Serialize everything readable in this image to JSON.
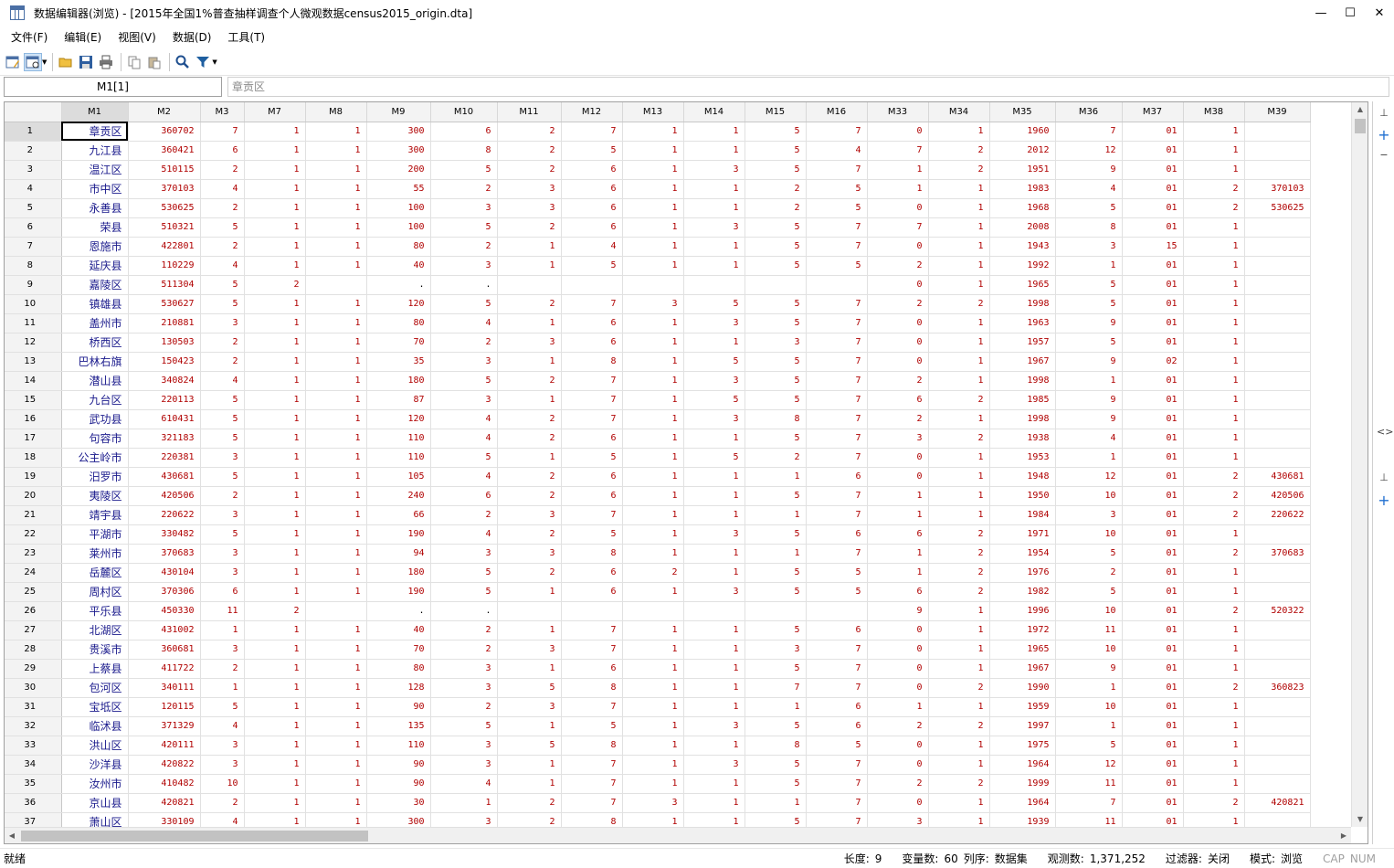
{
  "window": {
    "title": "数据编辑器(浏览) - [2015年全国1%普查抽样调查个人微观数据census2015_origin.dta]",
    "minimize": "—",
    "maximize": "☐",
    "close": "✕"
  },
  "menu": [
    "文件(F)",
    "编辑(E)",
    "视图(V)",
    "数据(D)",
    "工具(T)"
  ],
  "toolbar": {
    "icons": [
      "edit-mode-icon",
      "browse-mode-icon",
      "open-folder-icon",
      "save-icon",
      "print-icon",
      "copy-icon",
      "paste-icon",
      "search-icon",
      "filter-icon"
    ]
  },
  "cell_ref": "M1[1]",
  "cell_value": "章贡区",
  "columns": [
    "M1",
    "M2",
    "M3",
    "M7",
    "M8",
    "M9",
    "M10",
    "M11",
    "M12",
    "M13",
    "M14",
    "M15",
    "M16",
    "M33",
    "M34",
    "M35",
    "M36",
    "M37",
    "M38",
    "M39"
  ],
  "rows": [
    [
      "章贡区",
      "360702",
      "7",
      "1",
      "1",
      "300",
      "6",
      "2",
      "7",
      "1",
      "1",
      "5",
      "7",
      "0",
      "1",
      "1960",
      "7",
      "01",
      "1",
      ""
    ],
    [
      "九江县",
      "360421",
      "6",
      "1",
      "1",
      "300",
      "8",
      "2",
      "5",
      "1",
      "1",
      "5",
      "4",
      "7",
      "2",
      "2012",
      "12",
      "01",
      "1",
      ""
    ],
    [
      "温江区",
      "510115",
      "2",
      "1",
      "1",
      "200",
      "5",
      "2",
      "6",
      "1",
      "3",
      "5",
      "7",
      "1",
      "2",
      "1951",
      "9",
      "01",
      "1",
      ""
    ],
    [
      "市中区",
      "370103",
      "4",
      "1",
      "1",
      "55",
      "2",
      "3",
      "6",
      "1",
      "1",
      "2",
      "5",
      "1",
      "1",
      "1983",
      "4",
      "01",
      "2",
      "370103"
    ],
    [
      "永善县",
      "530625",
      "2",
      "1",
      "1",
      "100",
      "3",
      "3",
      "6",
      "1",
      "1",
      "2",
      "5",
      "0",
      "1",
      "1968",
      "5",
      "01",
      "2",
      "530625"
    ],
    [
      "荣县",
      "510321",
      "5",
      "1",
      "1",
      "100",
      "5",
      "2",
      "6",
      "1",
      "3",
      "5",
      "7",
      "7",
      "1",
      "2008",
      "8",
      "01",
      "1",
      ""
    ],
    [
      "恩施市",
      "422801",
      "2",
      "1",
      "1",
      "80",
      "2",
      "1",
      "4",
      "1",
      "1",
      "5",
      "7",
      "0",
      "1",
      "1943",
      "3",
      "15",
      "1",
      ""
    ],
    [
      "延庆县",
      "110229",
      "4",
      "1",
      "1",
      "40",
      "3",
      "1",
      "5",
      "1",
      "1",
      "5",
      "5",
      "2",
      "1",
      "1992",
      "1",
      "01",
      "1",
      ""
    ],
    [
      "嘉陵区",
      "511304",
      "5",
      "2",
      "",
      ".",
      ".",
      "",
      "",
      "",
      "",
      "",
      "",
      "0",
      "1",
      "1965",
      "5",
      "01",
      "1",
      ""
    ],
    [
      "镇雄县",
      "530627",
      "5",
      "1",
      "1",
      "120",
      "5",
      "2",
      "7",
      "3",
      "5",
      "5",
      "7",
      "2",
      "2",
      "1998",
      "5",
      "01",
      "1",
      ""
    ],
    [
      "盖州市",
      "210881",
      "3",
      "1",
      "1",
      "80",
      "4",
      "1",
      "6",
      "1",
      "3",
      "5",
      "7",
      "0",
      "1",
      "1963",
      "9",
      "01",
      "1",
      ""
    ],
    [
      "桥西区",
      "130503",
      "2",
      "1",
      "1",
      "70",
      "2",
      "3",
      "6",
      "1",
      "1",
      "3",
      "7",
      "0",
      "1",
      "1957",
      "5",
      "01",
      "1",
      ""
    ],
    [
      "巴林右旗",
      "150423",
      "2",
      "1",
      "1",
      "35",
      "3",
      "1",
      "8",
      "1",
      "5",
      "5",
      "7",
      "0",
      "1",
      "1967",
      "9",
      "02",
      "1",
      ""
    ],
    [
      "潜山县",
      "340824",
      "4",
      "1",
      "1",
      "180",
      "5",
      "2",
      "7",
      "1",
      "3",
      "5",
      "7",
      "2",
      "1",
      "1998",
      "1",
      "01",
      "1",
      ""
    ],
    [
      "九台区",
      "220113",
      "5",
      "1",
      "1",
      "87",
      "3",
      "1",
      "7",
      "1",
      "5",
      "5",
      "7",
      "6",
      "2",
      "1985",
      "9",
      "01",
      "1",
      ""
    ],
    [
      "武功县",
      "610431",
      "5",
      "1",
      "1",
      "120",
      "4",
      "2",
      "7",
      "1",
      "3",
      "8",
      "7",
      "2",
      "1",
      "1998",
      "9",
      "01",
      "1",
      ""
    ],
    [
      "句容市",
      "321183",
      "5",
      "1",
      "1",
      "110",
      "4",
      "2",
      "6",
      "1",
      "1",
      "5",
      "7",
      "3",
      "2",
      "1938",
      "4",
      "01",
      "1",
      ""
    ],
    [
      "公主岭市",
      "220381",
      "3",
      "1",
      "1",
      "110",
      "5",
      "1",
      "5",
      "1",
      "5",
      "2",
      "7",
      "0",
      "1",
      "1953",
      "1",
      "01",
      "1",
      ""
    ],
    [
      "汨罗市",
      "430681",
      "5",
      "1",
      "1",
      "105",
      "4",
      "2",
      "6",
      "1",
      "1",
      "1",
      "6",
      "0",
      "1",
      "1948",
      "12",
      "01",
      "2",
      "430681"
    ],
    [
      "夷陵区",
      "420506",
      "2",
      "1",
      "1",
      "240",
      "6",
      "2",
      "6",
      "1",
      "1",
      "5",
      "7",
      "1",
      "1",
      "1950",
      "10",
      "01",
      "2",
      "420506"
    ],
    [
      "靖宇县",
      "220622",
      "3",
      "1",
      "1",
      "66",
      "2",
      "3",
      "7",
      "1",
      "1",
      "1",
      "7",
      "1",
      "1",
      "1984",
      "3",
      "01",
      "2",
      "220622"
    ],
    [
      "平湖市",
      "330482",
      "5",
      "1",
      "1",
      "190",
      "4",
      "2",
      "5",
      "1",
      "3",
      "5",
      "6",
      "6",
      "2",
      "1971",
      "10",
      "01",
      "1",
      ""
    ],
    [
      "莱州市",
      "370683",
      "3",
      "1",
      "1",
      "94",
      "3",
      "3",
      "8",
      "1",
      "1",
      "1",
      "7",
      "1",
      "2",
      "1954",
      "5",
      "01",
      "2",
      "370683"
    ],
    [
      "岳麓区",
      "430104",
      "3",
      "1",
      "1",
      "180",
      "5",
      "2",
      "6",
      "2",
      "1",
      "5",
      "5",
      "1",
      "2",
      "1976",
      "2",
      "01",
      "1",
      ""
    ],
    [
      "周村区",
      "370306",
      "6",
      "1",
      "1",
      "190",
      "5",
      "1",
      "6",
      "1",
      "3",
      "5",
      "5",
      "6",
      "2",
      "1982",
      "5",
      "01",
      "1",
      ""
    ],
    [
      "平乐县",
      "450330",
      "11",
      "2",
      "",
      ".",
      ".",
      "",
      "",
      "",
      "",
      "",
      "",
      "9",
      "1",
      "1996",
      "10",
      "01",
      "2",
      "520322"
    ],
    [
      "北湖区",
      "431002",
      "1",
      "1",
      "1",
      "40",
      "2",
      "1",
      "7",
      "1",
      "1",
      "5",
      "6",
      "0",
      "1",
      "1972",
      "11",
      "01",
      "1",
      ""
    ],
    [
      "贵溪市",
      "360681",
      "3",
      "1",
      "1",
      "70",
      "2",
      "3",
      "7",
      "1",
      "1",
      "3",
      "7",
      "0",
      "1",
      "1965",
      "10",
      "01",
      "1",
      ""
    ],
    [
      "上蔡县",
      "411722",
      "2",
      "1",
      "1",
      "80",
      "3",
      "1",
      "6",
      "1",
      "1",
      "5",
      "7",
      "0",
      "1",
      "1967",
      "9",
      "01",
      "1",
      ""
    ],
    [
      "包河区",
      "340111",
      "1",
      "1",
      "1",
      "128",
      "3",
      "5",
      "8",
      "1",
      "1",
      "7",
      "7",
      "0",
      "2",
      "1990",
      "1",
      "01",
      "2",
      "360823"
    ],
    [
      "宝坻区",
      "120115",
      "5",
      "1",
      "1",
      "90",
      "2",
      "3",
      "7",
      "1",
      "1",
      "1",
      "6",
      "1",
      "1",
      "1959",
      "10",
      "01",
      "1",
      ""
    ],
    [
      "临沭县",
      "371329",
      "4",
      "1",
      "1",
      "135",
      "5",
      "1",
      "5",
      "1",
      "3",
      "5",
      "6",
      "2",
      "2",
      "1997",
      "1",
      "01",
      "1",
      ""
    ],
    [
      "洪山区",
      "420111",
      "3",
      "1",
      "1",
      "110",
      "3",
      "5",
      "8",
      "1",
      "1",
      "8",
      "5",
      "0",
      "1",
      "1975",
      "5",
      "01",
      "1",
      ""
    ],
    [
      "沙洋县",
      "420822",
      "3",
      "1",
      "1",
      "90",
      "3",
      "1",
      "7",
      "1",
      "3",
      "5",
      "7",
      "0",
      "1",
      "1964",
      "12",
      "01",
      "1",
      ""
    ],
    [
      "汝州市",
      "410482",
      "10",
      "1",
      "1",
      "90",
      "4",
      "1",
      "7",
      "1",
      "1",
      "5",
      "7",
      "2",
      "2",
      "1999",
      "11",
      "01",
      "1",
      ""
    ],
    [
      "京山县",
      "420821",
      "2",
      "1",
      "1",
      "30",
      "1",
      "2",
      "7",
      "3",
      "1",
      "1",
      "7",
      "0",
      "1",
      "1964",
      "7",
      "01",
      "2",
      "420821"
    ],
    [
      "萧山区",
      "330109",
      "4",
      "1",
      "1",
      "300",
      "3",
      "2",
      "8",
      "1",
      "1",
      "5",
      "7",
      "3",
      "1",
      "1939",
      "11",
      "01",
      "1",
      ""
    ]
  ],
  "status": {
    "ready": "就绪",
    "length_label": "长度:",
    "length": "9",
    "vars_label": "变量数:",
    "vars": "60",
    "order_label": "列序:",
    "order": "数据集",
    "obs_label": "观测数:",
    "obs": "1,371,252",
    "filter_label": "过滤器:",
    "filter": "关闭",
    "mode_label": "模式:",
    "mode": "浏览",
    "cap": "CAP",
    "num": "NUM"
  }
}
